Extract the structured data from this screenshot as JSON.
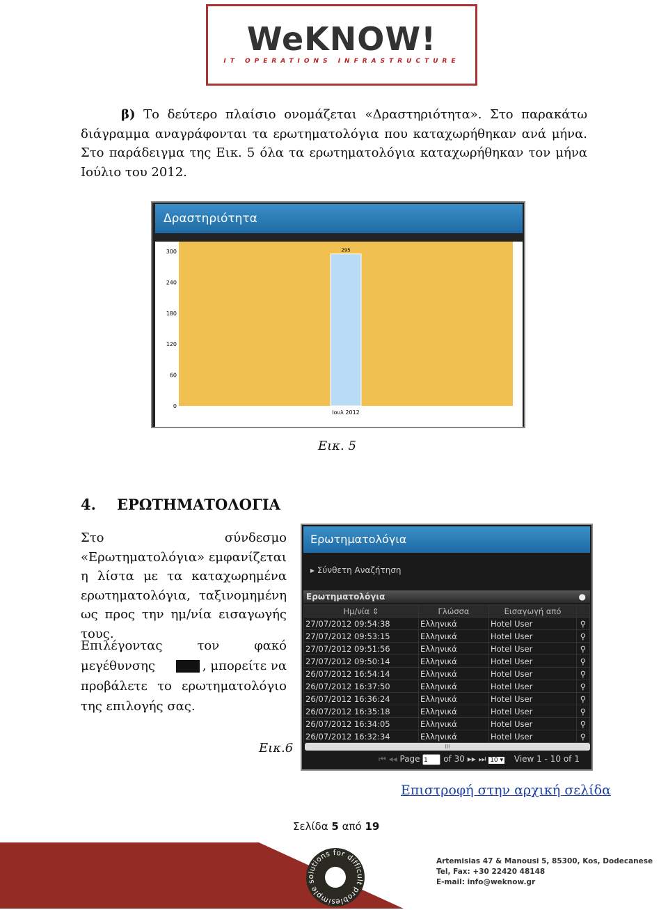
{
  "logo": {
    "brand": "WeKNOW!",
    "sub": "IT OPERATIONS INFRASTRUCTURE"
  },
  "intro": {
    "lead": "β)",
    "text": " Το δεύτερο πλαίσιο ονομάζεται «Δραστηριότητα». Στο παρακάτω διάγραμμα αναγράφονται τα ερωτηματολόγια που καταχωρήθηκαν ανά μήνα. Στο παράδειγμα της Εικ. 5 όλα τα ερωτηματολόγια καταχωρήθηκαν τον μήνα Ιούλιο του 2012."
  },
  "chart_data": {
    "type": "bar",
    "title": "Δραστηριότητα",
    "categories": [
      "Ιουλ 2012"
    ],
    "values": [
      295
    ],
    "data_labels": [
      "295"
    ],
    "ylim": [
      0,
      300
    ],
    "yticks": [
      0,
      60,
      120,
      180,
      240,
      300
    ],
    "colors": {
      "bar": "#b8dcf5",
      "background": "#f0c050"
    }
  },
  "fig5_caption": "Εικ. 5",
  "section": {
    "number": "4.",
    "title": "ΕΡΩΤΗΜΑΤΟΛΟΓΙΑ"
  },
  "para1": "Στο σύνδεσμο «Ερωτηματολόγια» εμφανίζεται η λίστα με τα καταχωρημένα ερωτηματολόγια, ταξινομημένη ως προς την ημ/νία εισαγωγής τους.",
  "para2a": "Επιλέγοντας τον φακό μεγέθυνσης",
  "para2b": ", μπορείτε να προβάλετε το ερωτηματολόγιο της επιλογής σας.",
  "fig6_caption": "Εικ.6",
  "panel": {
    "title": "Ερωτηματολόγια",
    "advanced": "Σύνθετη Αναζήτηση",
    "grid_title": "Ερωτηματολόγια",
    "columns": [
      "Ημ/νία",
      "Γλώσσα",
      "Εισαγωγή από"
    ],
    "rows": [
      [
        "27/07/2012 09:54:38",
        "Ελληνικά",
        "Hotel User"
      ],
      [
        "27/07/2012 09:53:15",
        "Ελληνικά",
        "Hotel User"
      ],
      [
        "27/07/2012 09:51:56",
        "Ελληνικά",
        "Hotel User"
      ],
      [
        "27/07/2012 09:50:14",
        "Ελληνικά",
        "Hotel User"
      ],
      [
        "26/07/2012 16:54:14",
        "Ελληνικά",
        "Hotel User"
      ],
      [
        "26/07/2012 16:37:50",
        "Ελληνικά",
        "Hotel User"
      ],
      [
        "26/07/2012 16:36:24",
        "Ελληνικά",
        "Hotel User"
      ],
      [
        "26/07/2012 16:35:18",
        "Ελληνικά",
        "Hotel User"
      ],
      [
        "26/07/2012 16:34:05",
        "Ελληνικά",
        "Hotel User"
      ],
      [
        "26/07/2012 16:32:34",
        "Ελληνικά",
        "Hotel User"
      ]
    ],
    "pager": {
      "page_label": "Page",
      "page": "1",
      "of": "of 30",
      "size": "10",
      "view": "View 1 - 10 of 1"
    }
  },
  "back_link": "Επιστροφή στην αρχική σελίδα",
  "page_num": {
    "a": "Σελίδα ",
    "n": "5",
    "b": " από ",
    "t": "19"
  },
  "footer": {
    "slogan": "simple solutions for difficult problems",
    "address": "Artemisias 47 & Manousi 5, 85300, Kos, Dodecanese",
    "tel": "Tel, Fax: +30 22420 48148",
    "email": "E-mail: info@weknow.gr"
  }
}
